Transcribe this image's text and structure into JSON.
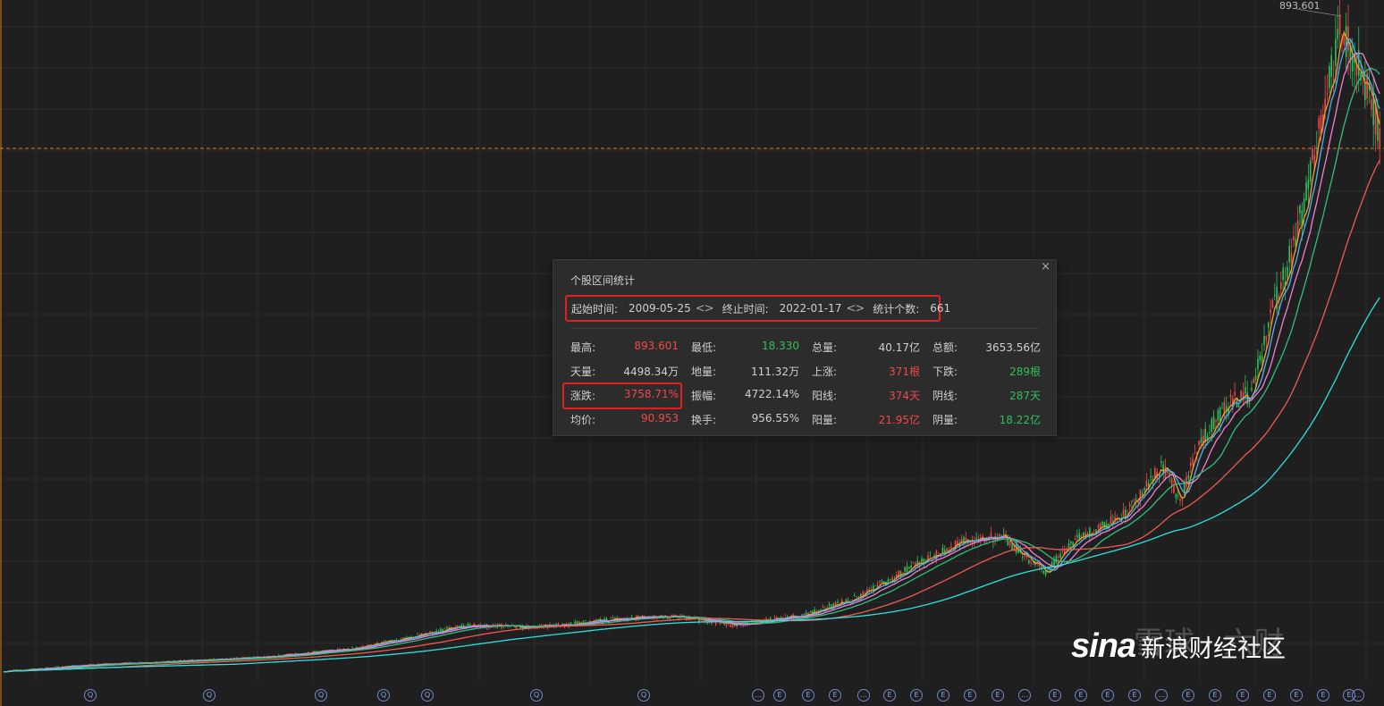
{
  "chart": {
    "max_price_label": "893.601",
    "colors": {
      "up": "#f04848",
      "down": "#2fc05a",
      "ma5": "#f0a030",
      "ma10": "#4fb0ff",
      "ma20": "#f080d0",
      "ma30": "#2fc07a",
      "ma60": "#f05a50",
      "ma120": "#30e0e0",
      "crosshair": "#e07820"
    }
  },
  "panel": {
    "title": "个股区间统计",
    "close": "×",
    "start_label": "起始时间:",
    "start_value": "2009-05-25",
    "end_label": "终止时间:",
    "end_value": "2022-01-17",
    "count_label": "统计个数:",
    "count_value": "661",
    "stats": [
      [
        {
          "label": "最高:",
          "value": "893.601",
          "c": "red"
        },
        {
          "label": "最低:",
          "value": "18.330",
          "c": "green"
        },
        {
          "label": "总量:",
          "value": "40.17亿",
          "c": "white"
        },
        {
          "label": "总额:",
          "value": "3653.56亿",
          "c": "white"
        }
      ],
      [
        {
          "label": "天量:",
          "value": "4498.34万",
          "c": "white"
        },
        {
          "label": "地量:",
          "value": "111.32万",
          "c": "white"
        },
        {
          "label": "上涨:",
          "value": "371根",
          "c": "red"
        },
        {
          "label": "下跌:",
          "value": "289根",
          "c": "green"
        }
      ],
      [
        {
          "label": "涨跌:",
          "value": "3758.71%",
          "c": "red"
        },
        {
          "label": "振幅:",
          "value": "4722.14%",
          "c": "white"
        },
        {
          "label": "阳线:",
          "value": "374天",
          "c": "red"
        },
        {
          "label": "阴线:",
          "value": "287天",
          "c": "green"
        }
      ],
      [
        {
          "label": "均价:",
          "value": "90.953",
          "c": "red"
        },
        {
          "label": "换手:",
          "value": "956.55%",
          "c": "white"
        },
        {
          "label": "阳量:",
          "value": "21.95亿",
          "c": "red"
        },
        {
          "label": "阴量:",
          "value": "18.22亿",
          "c": "green"
        }
      ]
    ]
  },
  "watermark": {
    "logo": "sina",
    "text": "新浪财经社区",
    "ghost": "雪球 · 六财"
  },
  "bottom_icons": [
    "Q",
    "Q",
    "Q",
    "Q",
    "Q",
    "Q",
    "Q",
    "…",
    "E",
    "E",
    "E",
    "…",
    "E",
    "E",
    "E",
    "E",
    "E",
    "…",
    "E",
    "E",
    "E",
    "E",
    "…",
    "E",
    "E",
    "E",
    "E",
    "E",
    "E",
    "E",
    "…"
  ]
}
